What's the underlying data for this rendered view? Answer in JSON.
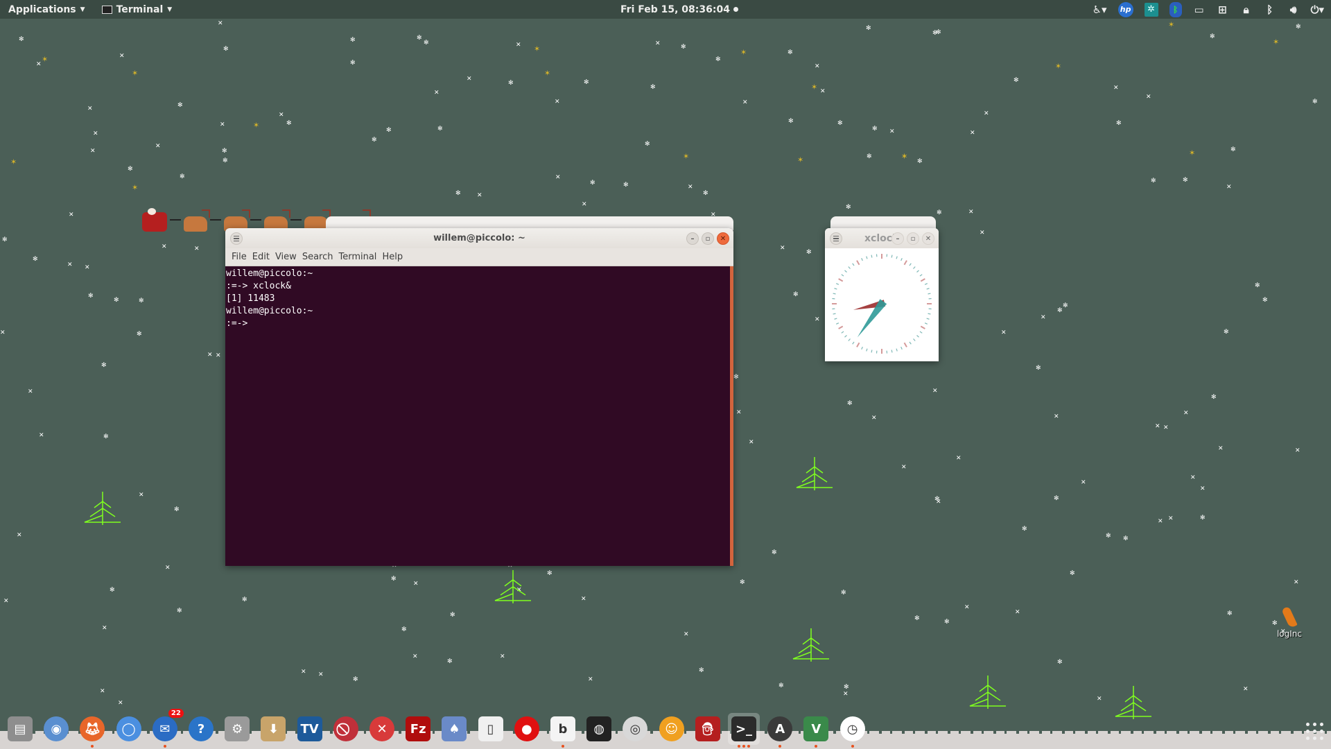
{
  "top_panel": {
    "applications_label": "Applications",
    "active_app_label": "Terminal",
    "datetime": "Fri Feb 15, 08:36:04",
    "tray_icons": [
      "accessibility-icon",
      "hp-icon",
      "teamviewer-icon",
      "bluetooth-app-icon",
      "sd-card-icon",
      "network-icon",
      "lock-icon",
      "bluetooth-icon",
      "volume-icon",
      "power-icon"
    ]
  },
  "terminal_window": {
    "title": "willem@piccolo: ~",
    "menu": [
      "File",
      "Edit",
      "View",
      "Search",
      "Terminal",
      "Help"
    ],
    "lines": [
      "willem@piccolo:~",
      ":=-> xclock&",
      "[1] 11483",
      "willem@piccolo:~",
      ":=->"
    ],
    "colors": {
      "background": "#300a24",
      "scrollbar": "#d2643d"
    }
  },
  "xclock_window": {
    "title": "xclock",
    "time_shown": {
      "hour": 8,
      "minute": 36
    },
    "colors": {
      "hour_hand": "#9b2c2c",
      "minute_hand": "#2f9a98",
      "major_ticks": "#d49a9a",
      "minor_ticks": "#7fb8b6"
    }
  },
  "desktop_icons": [
    {
      "label": "logInc"
    }
  ],
  "dock": {
    "items": [
      {
        "name": "file-cabinet",
        "label": "Files",
        "running": 0
      },
      {
        "name": "web-browser-globe",
        "label": "Web Browser",
        "running": 0
      },
      {
        "name": "firefox",
        "label": "Firefox",
        "running": 1
      },
      {
        "name": "chromium",
        "label": "Chromium",
        "running": 0
      },
      {
        "name": "thunderbird",
        "label": "Thunderbird",
        "running": 1,
        "badge": "22"
      },
      {
        "name": "help",
        "label": "Help",
        "running": 0
      },
      {
        "name": "system-tools",
        "label": "System Tools",
        "running": 0
      },
      {
        "name": "package-installer",
        "label": "Package Installer",
        "running": 0
      },
      {
        "name": "mythtv",
        "label": "mythTV",
        "running": 0
      },
      {
        "name": "block",
        "label": "Blocker",
        "running": 0
      },
      {
        "name": "xkill",
        "label": "xkill",
        "running": 0
      },
      {
        "name": "filezilla",
        "label": "FileZilla",
        "running": 0
      },
      {
        "name": "solitaire",
        "label": "Solitaire",
        "running": 0
      },
      {
        "name": "document",
        "label": "Document",
        "running": 0
      },
      {
        "name": "record",
        "label": "Recorder",
        "running": 0
      },
      {
        "name": "bluefish",
        "label": "Bluefish",
        "running": 1
      },
      {
        "name": "safe",
        "label": "Safe",
        "running": 0
      },
      {
        "name": "disc",
        "label": "Disc",
        "running": 0
      },
      {
        "name": "emoticon",
        "label": "Emoticon",
        "running": 0
      },
      {
        "name": "santa",
        "label": "Xsnow",
        "running": 0
      },
      {
        "name": "terminal",
        "label": "Terminal",
        "running": 3,
        "active": true
      },
      {
        "name": "software-updater",
        "label": "Software Updater",
        "running": 1
      },
      {
        "name": "vim",
        "label": "Vim",
        "running": 1
      },
      {
        "name": "clock",
        "label": "xclock",
        "running": 1
      }
    ],
    "show_apps_label": "Show Applications"
  }
}
